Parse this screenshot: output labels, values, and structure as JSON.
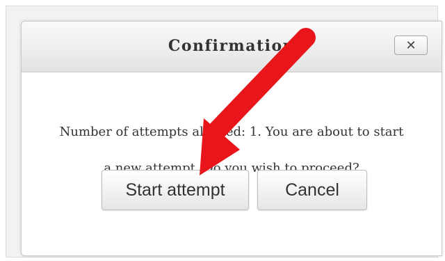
{
  "dialog": {
    "title": "Confirmation",
    "close_label": "✕",
    "message_line1": "Number of attempts allowed: 1. You are about to start",
    "message_line2": "a new attempt. Do you wish to proceed?",
    "start_button": "Start attempt",
    "cancel_button": "Cancel"
  },
  "annotation": {
    "arrow_color": "#e8161b",
    "arrow_icon": "red-arrow-icon"
  }
}
